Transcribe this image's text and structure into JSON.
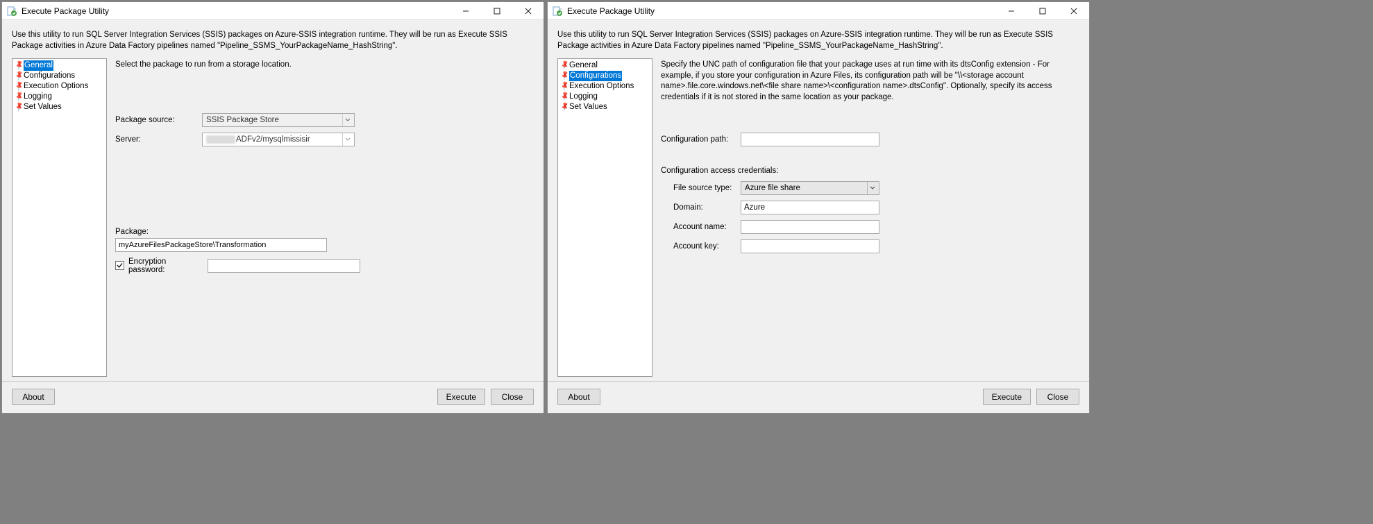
{
  "app_title": "Execute Package Utility",
  "intro_text": "Use this utility to run SQL Server Integration Services (SSIS) packages on Azure-SSIS integration runtime. They will be run as Execute SSIS Package activities in Azure Data Factory pipelines named \"Pipeline_SSMS_YourPackageName_HashString\".",
  "nav": {
    "general": "General",
    "configurations": "Configurations",
    "execution_options": "Execution Options",
    "logging": "Logging",
    "set_values": "Set Values"
  },
  "left": {
    "desc": "Select the package to run from a storage location.",
    "package_source_label": "Package source:",
    "package_source_value": "SSIS Package Store",
    "server_label": "Server:",
    "server_value_suffix": "ADFv2/mysqlmissisir",
    "package_label": "Package:",
    "package_value": "myAzureFilesPackageStore\\Transformation",
    "encryption_label": "Encryption password:"
  },
  "right": {
    "desc": "Specify the UNC path of configuration file that your package uses at run time with its dtsConfig extension - For example, if you store your configuration in Azure Files, its configuration path will be \"\\\\<storage account name>.file.core.windows.net\\<file share name>\\<configuration name>.dtsConfig\".  Optionally, specify its access credentials if it is not stored in the same location as your package.",
    "config_path_label": "Configuration path:",
    "config_path_value": "",
    "credentials_header": "Configuration access credentials:",
    "file_source_label": "File source type:",
    "file_source_value": "Azure file share",
    "domain_label": "Domain:",
    "domain_value": "Azure",
    "account_name_label": "Account name:",
    "account_name_value": "",
    "account_key_label": "Account key:",
    "account_key_value": ""
  },
  "buttons": {
    "about": "About",
    "execute": "Execute",
    "close": "Close"
  }
}
